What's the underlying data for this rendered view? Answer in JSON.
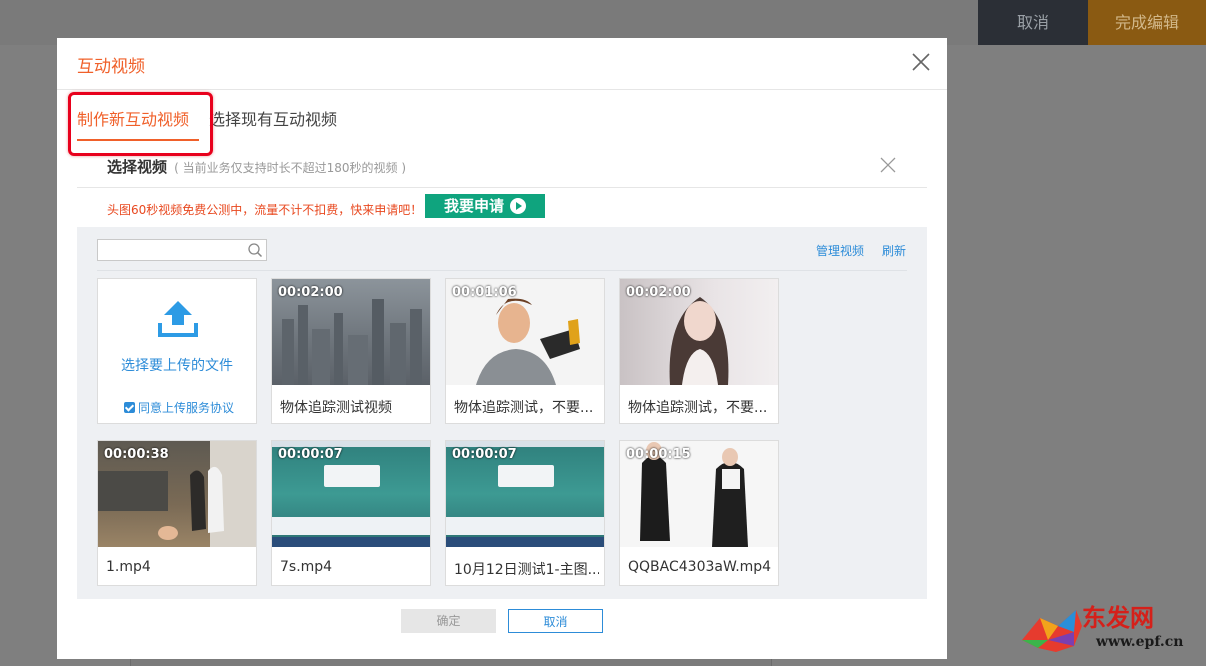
{
  "topbar": {
    "cancel_label": "取消",
    "done_label": "完成编辑"
  },
  "dialog": {
    "title": "互动视频",
    "tabs": [
      {
        "label": "制作新互动视频",
        "active": true
      },
      {
        "label": "选择现有互动视频",
        "active": false
      }
    ],
    "section": {
      "title": "选择视频",
      "hint": "( 当前业务仅支持时长不超过180秒的视频 )"
    },
    "promo": {
      "text": "头图60秒视频免费公测中，流量不计不扣费，快来申请吧！",
      "button_label": "我要申请"
    },
    "toolbar": {
      "search_placeholder": "",
      "manage_label": "管理视频",
      "refresh_label": "刷新"
    },
    "upload": {
      "label": "选择要上传的文件",
      "agree_label": "同意上传服务协议",
      "agree_checked": true
    },
    "videos": [
      {
        "duration": "00:02:00",
        "name": "物体追踪测试视频"
      },
      {
        "duration": "00:01:06",
        "name": "物体追踪测试，不要..."
      },
      {
        "duration": "00:02:00",
        "name": "物体追踪测试，不要..."
      },
      {
        "duration": "00:00:38",
        "name": "1.mp4"
      },
      {
        "duration": "00:00:07",
        "name": "7s.mp4"
      },
      {
        "duration": "00:00:07",
        "name": "10月12日测试1-主图..."
      },
      {
        "duration": "00:00:15",
        "name": "QQBAC4303aW.mp4"
      }
    ],
    "buttons": {
      "ok_label": "确定",
      "cancel_label": "取消"
    }
  },
  "watermark": {
    "brand": "东发网",
    "url": "www.epf.cn"
  },
  "colors": {
    "accent": "#f0602a",
    "link": "#2d8cd8",
    "promo_button": "#0fa47e",
    "highlight_box": "#e8001c"
  }
}
